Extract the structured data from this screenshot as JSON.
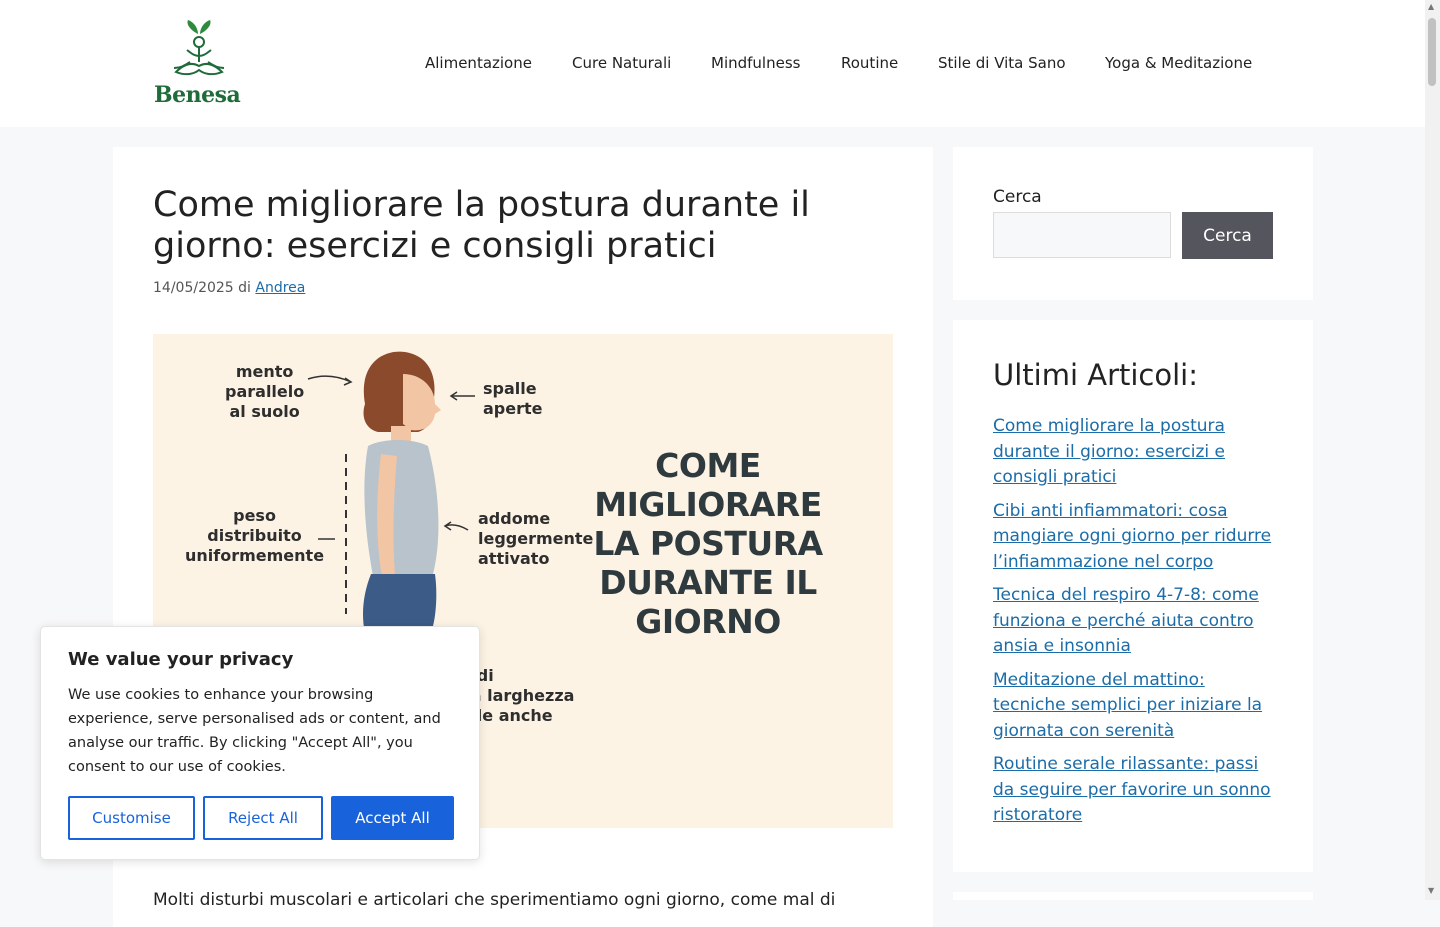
{
  "header": {
    "logo_text": "Benesa",
    "nav": [
      "Alimentazione",
      "Cure Naturali",
      "Mindfulness",
      "Routine",
      "Stile di Vita Sano",
      "Yoga & Meditazione"
    ]
  },
  "article": {
    "title": "Come migliorare la postura durante il giorno: esercizi e consigli pratici",
    "date": "14/05/2025",
    "by": "di",
    "author": "Andrea",
    "hero": {
      "title": "COME MIGLIORARE LA POSTURA DURANTE IL GIORNO",
      "labels": {
        "chin": "mento\nparallelo\nal suolo",
        "shoulders": "spalle\naperte",
        "weight": "peso\ndistribuito\nuniformemente",
        "abs": "addome\nleggermente\nattivato",
        "feet": "piedi\nalla larghezza\ndelle anche"
      }
    },
    "intro": "Molti disturbi muscolari e articolari che sperimentiamo ogni giorno, come mal di"
  },
  "sidebar": {
    "search_label": "Cerca",
    "search_value": "",
    "search_button": "Cerca",
    "recent_title": "Ultimi Articoli:",
    "recent": [
      "Come migliorare la postura durante il giorno: esercizi e consigli pratici",
      "Cibi anti infiammatori: cosa mangiare ogni giorno per ridurre l’infiammazione nel corpo",
      "Tecnica del respiro 4-7-8: come funziona e perché aiuta contro ansia e insonnia",
      "Meditazione del mattino: tecniche semplici per iniziare la giornata con serenità",
      "Routine serale rilassante: passi da seguire per favorire un sonno ristoratore"
    ]
  },
  "cookie": {
    "title": "We value your privacy",
    "text": "We use cookies to enhance your browsing experience, serve personalised ads or content, and analyse our traffic. By clicking \"Accept All\", you consent to our use of cookies.",
    "customise": "Customise",
    "reject": "Reject All",
    "accept": "Accept All"
  },
  "colors": {
    "brand_green": "#1f6b3a",
    "link": "#1b6ca8",
    "cookie_blue": "#1863dc",
    "search_button": "#55555e"
  }
}
